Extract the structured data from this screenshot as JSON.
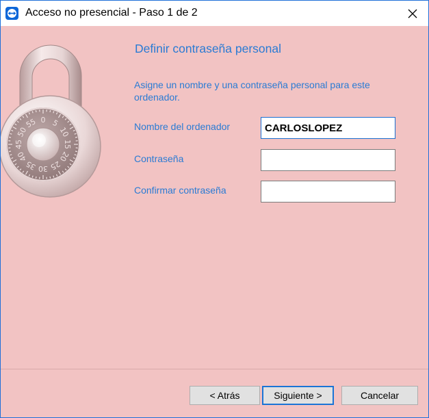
{
  "window": {
    "title": "Acceso no presencial - Paso 1 de 2",
    "app_icon": "teamviewer-icon",
    "close_icon": "close-icon"
  },
  "illustration": {
    "icon": "combination-padlock-icon",
    "dial_numbers": [
      "0",
      "5",
      "10",
      "15",
      "20",
      "25",
      "30",
      "35",
      "40",
      "45",
      "50",
      "55"
    ]
  },
  "page": {
    "heading": "Definir contraseña personal",
    "description": "Asigne un nombre y una contraseña personal para este ordenador."
  },
  "form": {
    "computer_name_label": "Nombre del ordenador",
    "computer_name_value": "CARLOSLOPEZ",
    "password_label": "Contraseña",
    "password_value": "",
    "confirm_password_label": "Confirmar contraseña",
    "confirm_password_value": ""
  },
  "buttons": {
    "back": "< Atrás",
    "next": "Siguiente >",
    "cancel": "Cancelar"
  },
  "colors": {
    "background": "#f2c3c3",
    "accent_text": "#2a7bd4",
    "focus_border": "#1a6fd1"
  }
}
